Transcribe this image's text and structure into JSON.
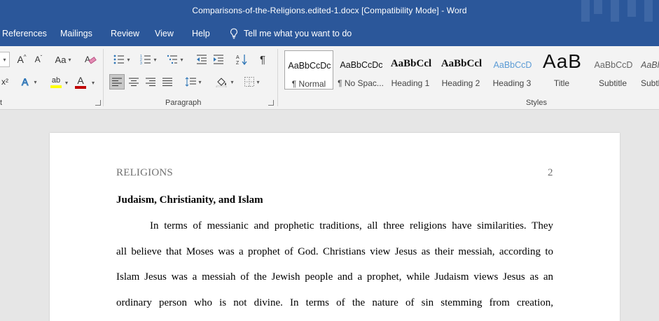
{
  "window": {
    "title": "Comparisons-of-the-Religions.edited-1.docx [Compatibility Mode]  -  Word"
  },
  "menu": {
    "tabs": [
      "References",
      "Mailings",
      "Review",
      "View",
      "Help"
    ],
    "tell_me": "Tell me what you want to do"
  },
  "ribbon": {
    "font": {
      "grow_label": "A",
      "shrink_label": "A",
      "case_label": "Aa",
      "superscript_label": "x²",
      "font_color_label": "A",
      "highlight_label": "ab"
    },
    "paragraph": {
      "label": "Paragraph",
      "pilcrow": "¶"
    },
    "styles": {
      "label": "Styles",
      "items": [
        {
          "sample": "AaBbCcDc",
          "name": "¶ Normal"
        },
        {
          "sample": "AaBbCcDc",
          "name": "¶ No Spac..."
        },
        {
          "sample": "AaBbCcl",
          "name": "Heading 1"
        },
        {
          "sample": "AaBbCcl",
          "name": "Heading 2"
        },
        {
          "sample": "AaBbCcD",
          "name": "Heading 3"
        },
        {
          "sample": "AaB",
          "name": "Title"
        },
        {
          "sample": "AaBbCcD",
          "name": "Subtitle"
        },
        {
          "sample": "AaBl",
          "name": "Subtl"
        }
      ]
    },
    "font_group_label": "t"
  },
  "document": {
    "running_head": "RELIGIONS",
    "page_number": "2",
    "heading": "Judaism, Christianity, and Islam",
    "lines": [
      "In terms of messianic and prophetic traditions, all three religions have similarities. They",
      "all believe that Moses was a prophet of God. Christians view Jesus as their messiah, according to",
      "Islam Jesus was a messiah of the Jewish people and a prophet, while Judaism views Jesus as an",
      "ordinary person who is not divine. In terms of the nature of sin stemming from creation,"
    ]
  },
  "colors": {
    "title_bar": "#2b579a",
    "ribbon_bg": "#f3f3f3",
    "doc_bg": "#e6e6e6",
    "font_color_red": "#c00000",
    "highlight_yellow": "#ffff00",
    "heading_blue": "#5b9bd5"
  }
}
